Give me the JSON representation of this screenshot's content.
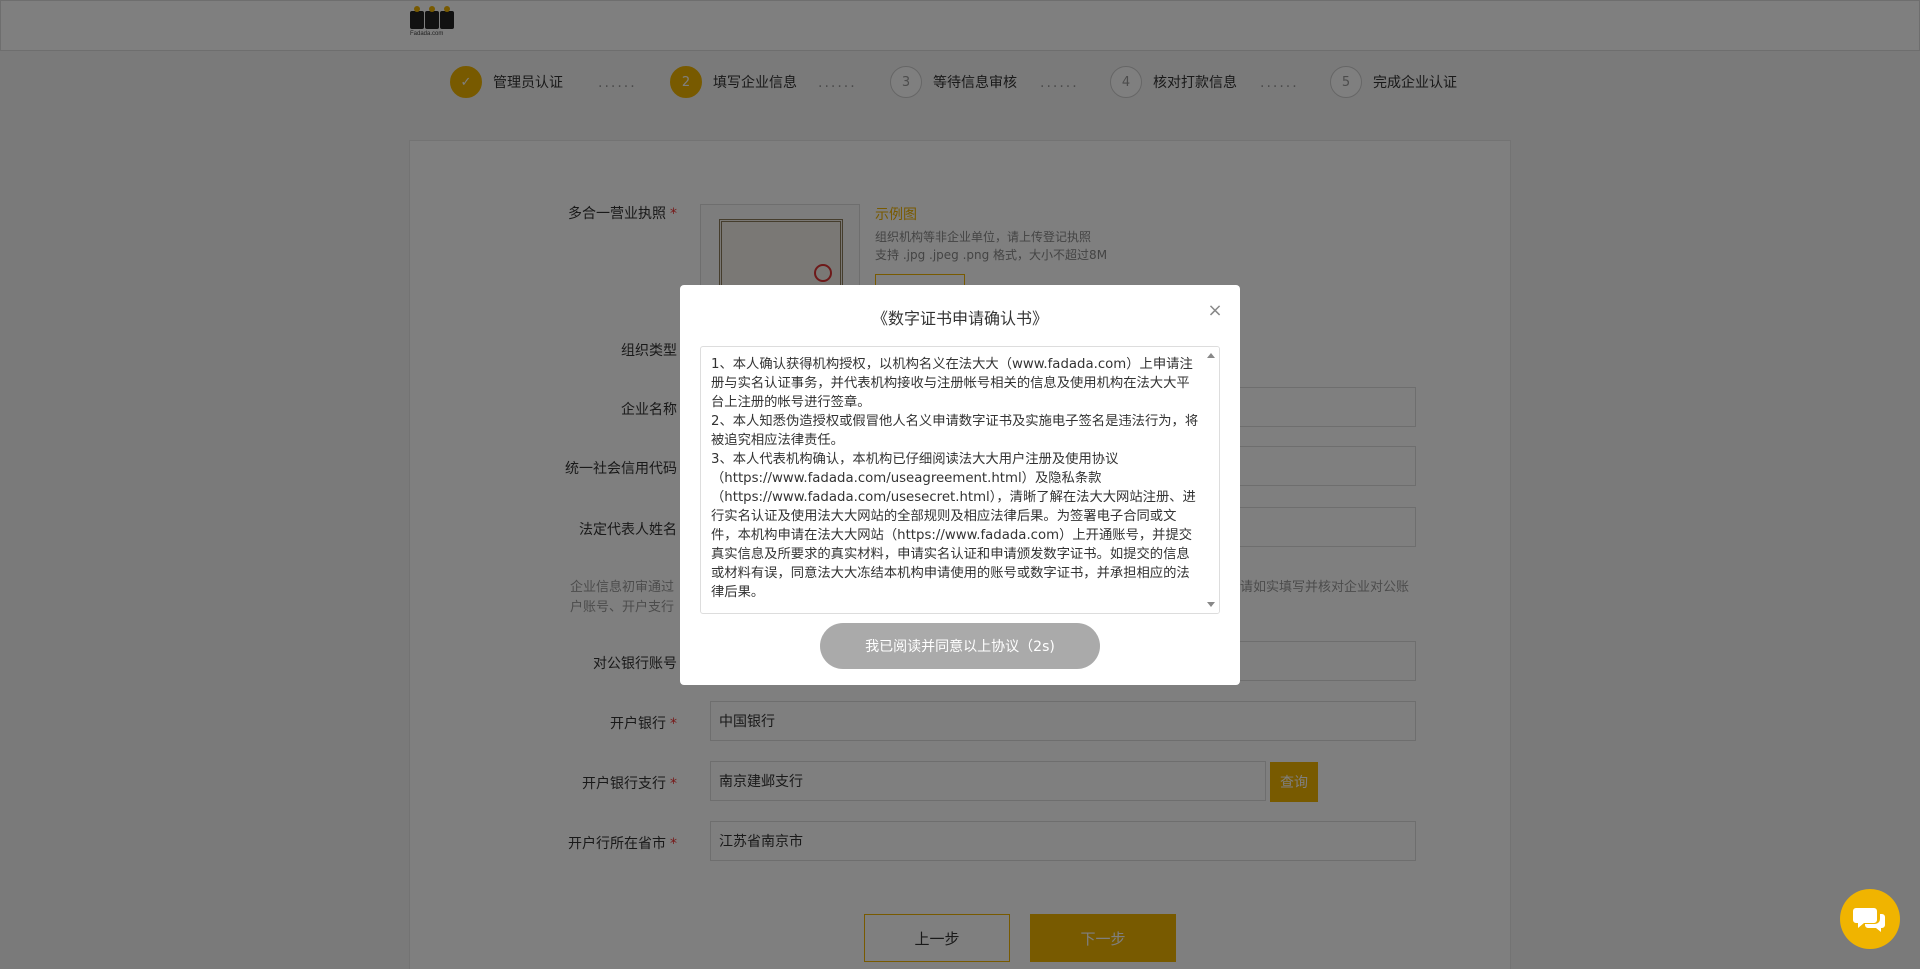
{
  "header": {
    "logo_sub": "Fadada.com"
  },
  "steps": [
    {
      "num": "✓",
      "label": "管理员认证",
      "state": "done"
    },
    {
      "num": "2",
      "label": "填写企业信息",
      "state": "active"
    },
    {
      "num": "3",
      "label": "等待信息审核",
      "state": "todo"
    },
    {
      "num": "4",
      "label": "核对打款信息",
      "state": "todo"
    },
    {
      "num": "5",
      "label": "完成企业认证",
      "state": "todo"
    }
  ],
  "step_separator": "······",
  "form": {
    "license_label": "多合一营业执照",
    "required_mark": "*",
    "example_link": "示例图",
    "hint1": "组织机构等非企业单位，请上传登记执照",
    "hint2": "支持 .jpg .jpeg .png 格式，大小不超过8M",
    "org_type_label": "组织类型",
    "company_name_label": "企业名称",
    "credit_code_label": "统一社会信用代码",
    "legal_rep_label": "法定代表人姓名",
    "note_left": "企业信息初审通过",
    "note_left2": "户账号、开户支行",
    "note_right": "请如实填写并核对企业对公账",
    "bank_account_label": "对公银行账号",
    "bank_label": "开户银行",
    "bank_value": "中国银行",
    "branch_label": "开户银行支行",
    "branch_value": "南京建邺支行",
    "query_button": "查询",
    "province_label": "开户行所在省市",
    "province_value": "江苏省南京市",
    "prev_button": "上一步",
    "next_button": "下一步"
  },
  "modal": {
    "title": "《数字证书申请确认书》",
    "close": "×",
    "paragraphs": [
      "1、本人确认获得机构授权，以机构名义在法大大（www.fadada.com）上申请注册与实名认证事务，并代表机构接收与注册帐号相关的信息及使用机构在法大大平台上注册的帐号进行签章。",
      "2、本人知悉伪造授权或假冒他人名义申请数字证书及实施电子签名是违法行为，将被追究相应法律责任。",
      "3、本人代表机构确认，本机构已仔细阅读法大大用户注册及使用协议（https://www.fadada.com/useagreement.html）及隐私条款（https://www.fadada.com/usesecret.html），清晰了解在法大大网站注册、进行实名认证及使用法大大网站的全部规则及相应法律后果。为签署电子合同或文件，本机构申请在法大大网站（https://www.fadada.com）上开通账号，并提交真实信息及所要求的真实材料，申请实名认证和申请颁发数字证书。如提交的信息或材料有误，同意法大大冻结本机构申请使用的账号或数字证书，并承担相应的法律后果。"
    ],
    "agree_button": "我已阅读并同意以上协议（2s)"
  }
}
